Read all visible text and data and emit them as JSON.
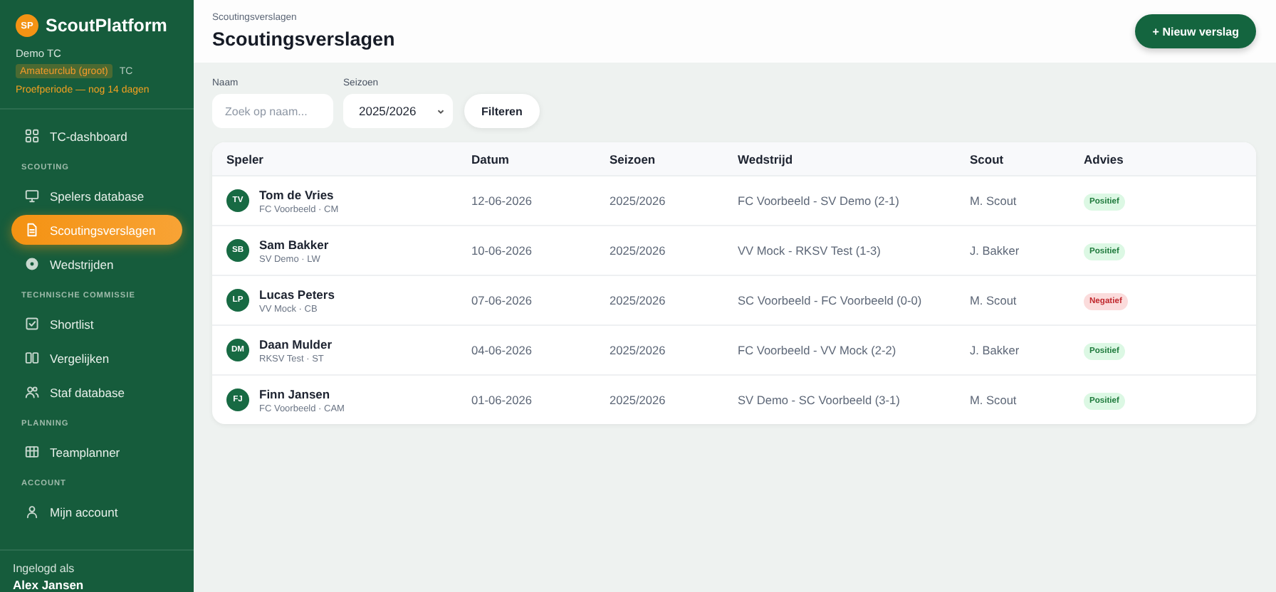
{
  "brand": {
    "logo": "SP",
    "name": "ScoutPlatform",
    "org": "Demo TC",
    "plan_badge": "Amateurclub (groot)",
    "role": "TC",
    "trial": "Proefperiode — nog 14 dagen"
  },
  "sidebar": {
    "sections": [
      {
        "items": [
          {
            "label": "TC-dashboard",
            "selected": false
          }
        ]
      },
      {
        "heading": "SCOUTING",
        "items": [
          {
            "label": "Spelers database",
            "selected": false
          },
          {
            "label": "Scoutingsverslagen",
            "selected": true
          },
          {
            "label": "Wedstrijden",
            "selected": false
          }
        ]
      },
      {
        "heading": "TECHNISCHE COMMISSIE",
        "items": [
          {
            "label": "Shortlist",
            "selected": false
          },
          {
            "label": "Vergelijken",
            "selected": false
          },
          {
            "label": "Staf database",
            "selected": false
          }
        ]
      },
      {
        "heading": "PLANNING",
        "items": [
          {
            "label": "Teamplanner",
            "selected": false
          }
        ]
      },
      {
        "heading": "ACCOUNT",
        "items": [
          {
            "label": "Mijn account",
            "selected": false
          }
        ]
      }
    ],
    "footer": {
      "caption": "Ingelogd als",
      "user": "Alex Jansen"
    }
  },
  "header": {
    "breadcrumb": "Scoutingsverslagen",
    "title": "Scoutingsverslagen",
    "new_button": "+ Nieuw verslag"
  },
  "filters": {
    "name": {
      "label": "Naam",
      "placeholder": "Zoek op naam..."
    },
    "season": {
      "label": "Seizoen",
      "value": "2025/2026"
    },
    "button": "Filteren"
  },
  "table": {
    "columns": [
      "Speler",
      "Datum",
      "Seizoen",
      "Wedstrijd",
      "Scout",
      "Advies"
    ],
    "rows": [
      {
        "initials": "TV",
        "name": "Tom de Vries",
        "meta": "FC Voorbeeld · CM",
        "date": "12-06-2026",
        "season": "2025/2026",
        "match": "FC Voorbeeld - SV Demo (2-1)",
        "scout": "M. Scout",
        "advice": "Positief",
        "kind": "positive"
      },
      {
        "initials": "SB",
        "name": "Sam Bakker",
        "meta": "SV Demo · LW",
        "date": "10-06-2026",
        "season": "2025/2026",
        "match": "VV Mock - RKSV Test (1-3)",
        "scout": "J. Bakker",
        "advice": "Positief",
        "kind": "positive"
      },
      {
        "initials": "LP",
        "name": "Lucas Peters",
        "meta": "VV Mock · CB",
        "date": "07-06-2026",
        "season": "2025/2026",
        "match": "SC Voorbeeld - FC Voorbeeld (0-0)",
        "scout": "M. Scout",
        "advice": "Negatief",
        "kind": "negative"
      },
      {
        "initials": "DM",
        "name": "Daan Mulder",
        "meta": "RKSV Test · ST",
        "date": "04-06-2026",
        "season": "2025/2026",
        "match": "FC Voorbeeld - VV Mock (2-2)",
        "scout": "J. Bakker",
        "advice": "Positief",
        "kind": "positive"
      },
      {
        "initials": "FJ",
        "name": "Finn Jansen",
        "meta": "FC Voorbeeld · CAM",
        "date": "01-06-2026",
        "season": "2025/2026",
        "match": "SV Demo - SC Voorbeeld (3-1)",
        "scout": "M. Scout",
        "advice": "Positief",
        "kind": "positive"
      }
    ]
  }
}
